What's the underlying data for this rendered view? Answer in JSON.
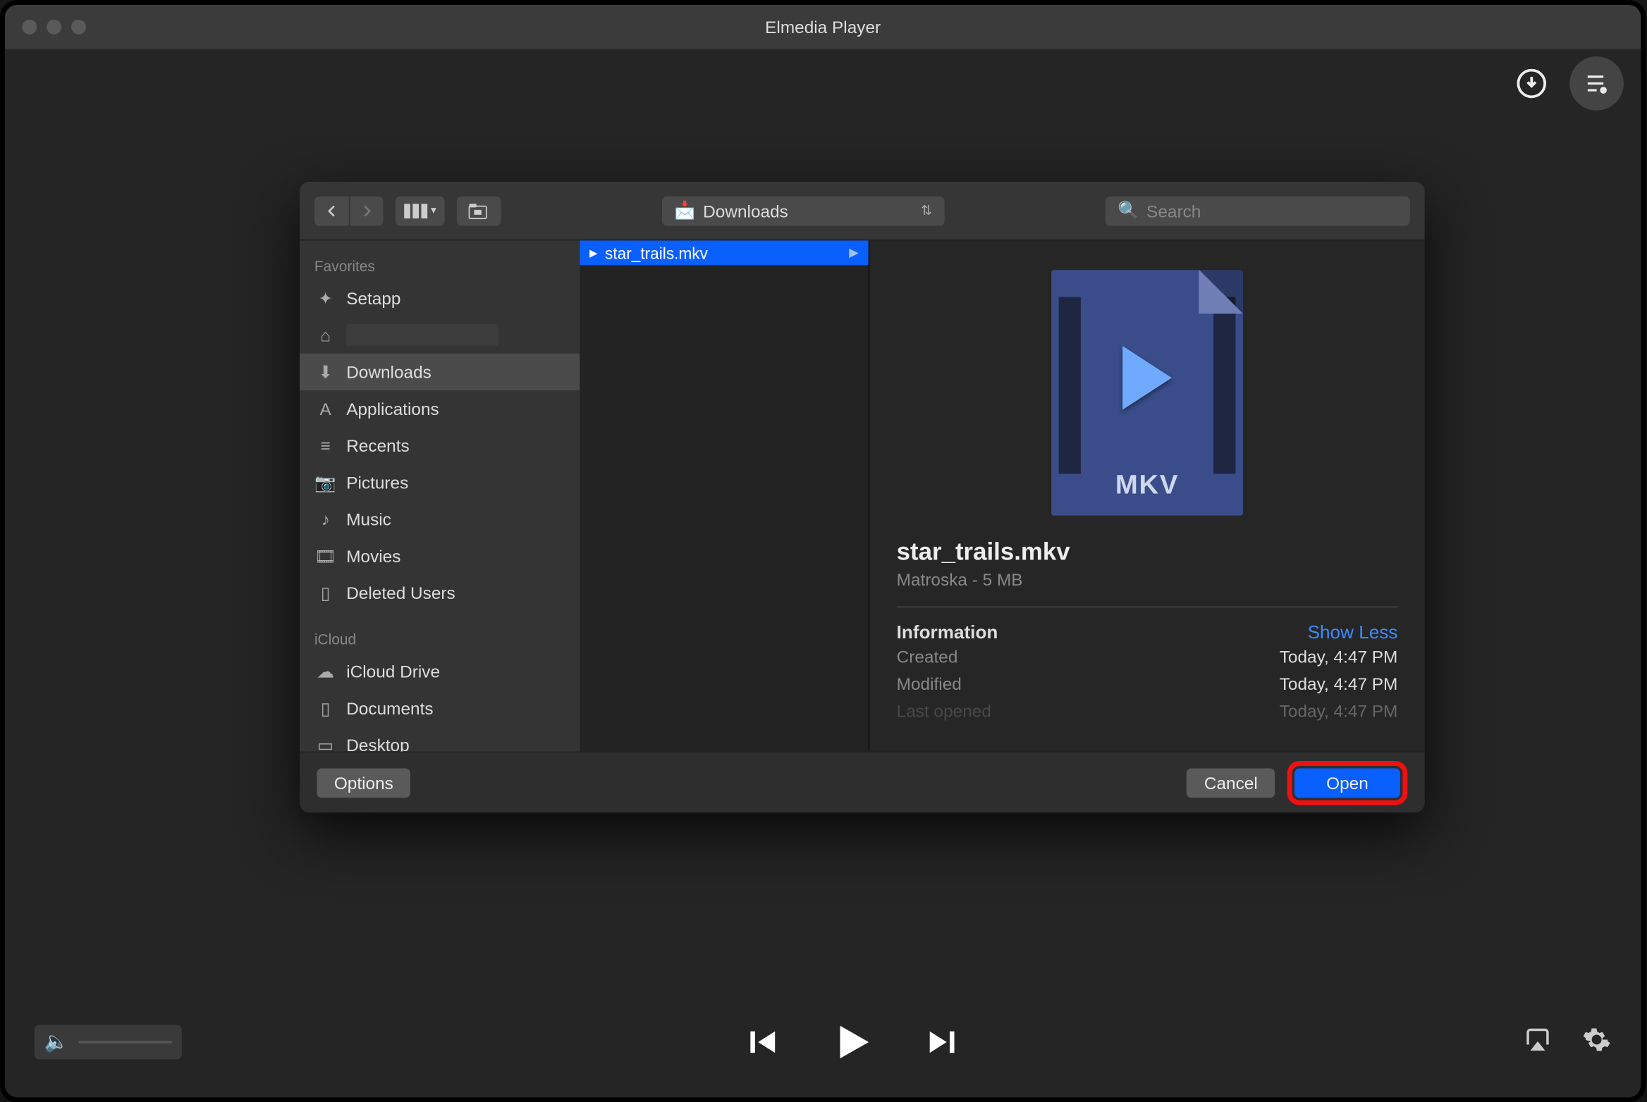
{
  "app": {
    "title": "Elmedia Player"
  },
  "dialog": {
    "path_label": "Downloads",
    "search_placeholder": "Search",
    "sidebar": {
      "favorites_header": "Favorites",
      "items": [
        {
          "label": "Setapp"
        },
        {
          "label": ""
        },
        {
          "label": "Downloads"
        },
        {
          "label": "Applications"
        },
        {
          "label": "Recents"
        },
        {
          "label": "Pictures"
        },
        {
          "label": "Music"
        },
        {
          "label": "Movies"
        },
        {
          "label": "Deleted Users"
        }
      ],
      "icloud_header": "iCloud",
      "icloud_items": [
        {
          "label": "iCloud Drive"
        },
        {
          "label": "Documents"
        },
        {
          "label": "Desktop"
        }
      ]
    },
    "files": [
      {
        "name": "star_trails.mkv"
      }
    ],
    "preview": {
      "name": "star_trails.mkv",
      "subtitle": "Matroska - 5 MB",
      "thumb_label": "MKV",
      "info_header": "Information",
      "show_less": "Show Less",
      "rows": [
        {
          "label": "Created",
          "value": "Today, 4:47 PM"
        },
        {
          "label": "Modified",
          "value": "Today, 4:47 PM"
        },
        {
          "label": "Last opened",
          "value": "Today, 4:47 PM"
        }
      ]
    },
    "footer": {
      "options": "Options",
      "cancel": "Cancel",
      "open": "Open"
    }
  }
}
